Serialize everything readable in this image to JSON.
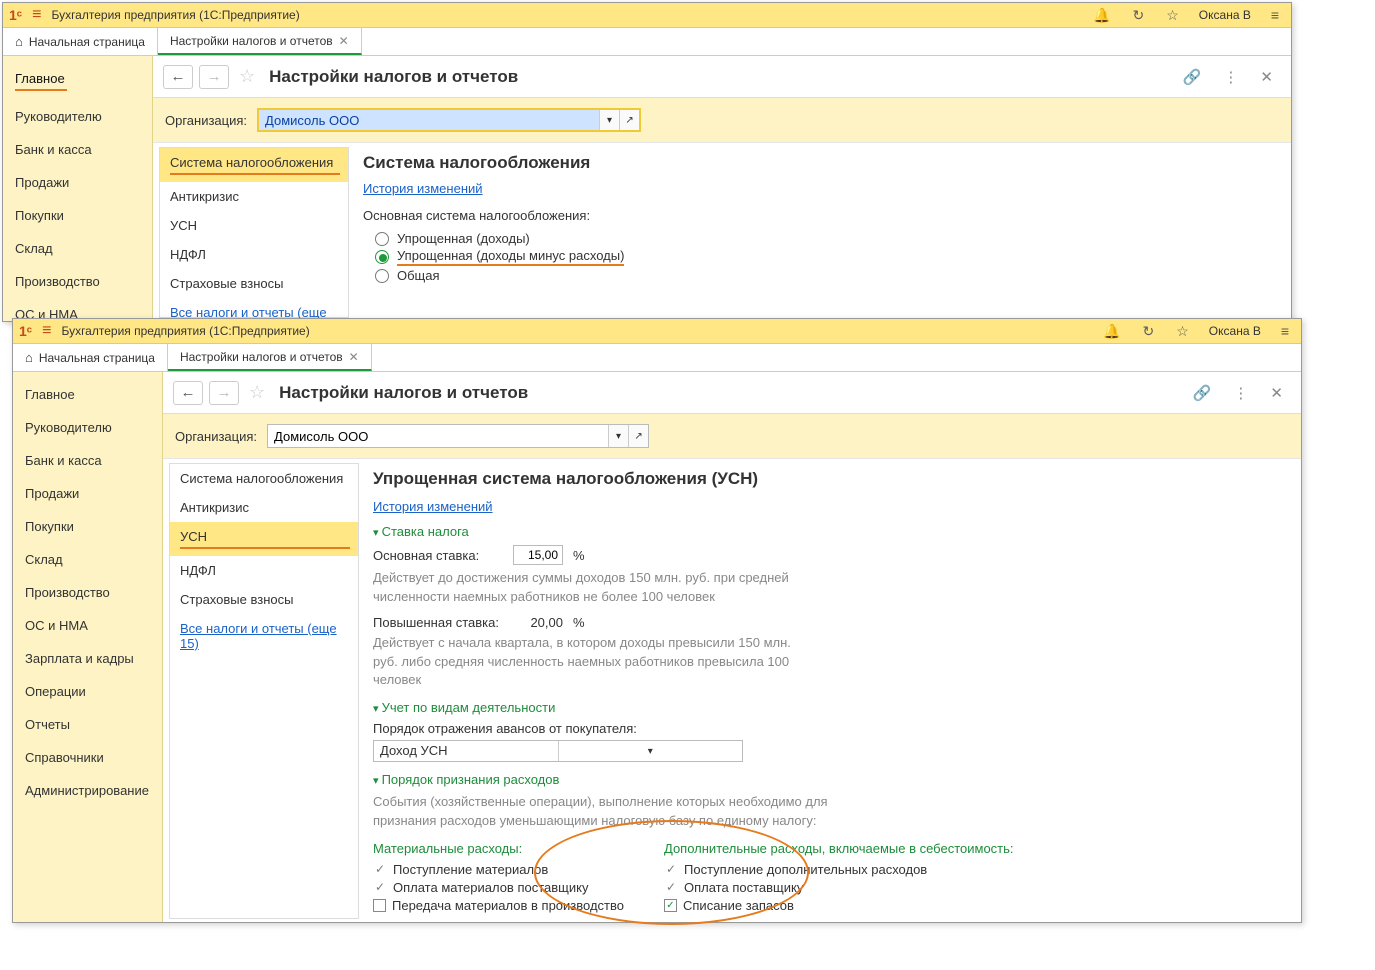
{
  "app": {
    "title": "Бухгалтерия предприятия  (1С:Предприятие)",
    "user": "Оксана В"
  },
  "tabs": {
    "home": "Начальная страница",
    "t1": "Настройки налогов и отчетов"
  },
  "sidebar": {
    "items": [
      {
        "label": "Главное"
      },
      {
        "label": "Руководителю"
      },
      {
        "label": "Банк и касса"
      },
      {
        "label": "Продажи"
      },
      {
        "label": "Покупки"
      },
      {
        "label": "Склад"
      },
      {
        "label": "Производство"
      },
      {
        "label": "ОС и НМА"
      },
      {
        "label": "Зарплата и кадры"
      },
      {
        "label": "Операции"
      },
      {
        "label": "Отчеты"
      },
      {
        "label": "Справочники"
      },
      {
        "label": "Администрирование"
      }
    ]
  },
  "page": {
    "title": "Настройки налогов и отчетов"
  },
  "org": {
    "label": "Организация:",
    "value": "Домисоль ООО"
  },
  "subnav": {
    "items": [
      {
        "label": "Система налогообложения"
      },
      {
        "label": "Антикризис"
      },
      {
        "label": "УСН"
      },
      {
        "label": "НДФЛ"
      },
      {
        "label": "Страховые взносы"
      }
    ],
    "all_link": "Все налоги и отчеты (еще 15)"
  },
  "pane1": {
    "heading": "Система налогообложения",
    "history_link": "История изменений",
    "sys_label": "Основная система налогообложения:",
    "r1": "Упрощенная (доходы)",
    "r2": "Упрощенная (доходы минус расходы)",
    "r3": "Общая"
  },
  "pane2": {
    "heading": "Упрощенная система налогообложения (УСН)",
    "history_link": "История изменений",
    "sec_rate": "Ставка налога",
    "rate_main_label": "Основная ставка:",
    "rate_main": "15,00",
    "pct": "%",
    "rate_main_note": "Действует до достижения суммы доходов 150 млн. руб. при средней численности наемных работников не более 100 человек",
    "rate_hi_label": "Повышенная ставка:",
    "rate_hi": "20,00",
    "rate_hi_note": "Действует с начала квартала, в котором доходы превысили 150 млн. руб. либо средняя численность наемных работников превысила 100 человек",
    "sec_act": "Учет по видам деятельности",
    "adv_label": "Порядок отражения авансов от покупателя:",
    "adv_value": "Доход УСН",
    "sec_exp": "Порядок признания расходов",
    "exp_note": "События (хозяйственные операции), выполнение которых необходимо для признания расходов уменьшающими налоговую базу по единому налогу:",
    "mat_h": "Материальные расходы:",
    "mat1": "Поступление материалов",
    "mat2": "Оплата материалов поставщику",
    "mat3": "Передача материалов в производство",
    "add_h": "Дополнительные расходы, включаемые в себестоимость:",
    "add1": "Поступление дополнительных расходов",
    "add2": "Оплата поставщику",
    "add3": "Списание запасов"
  }
}
